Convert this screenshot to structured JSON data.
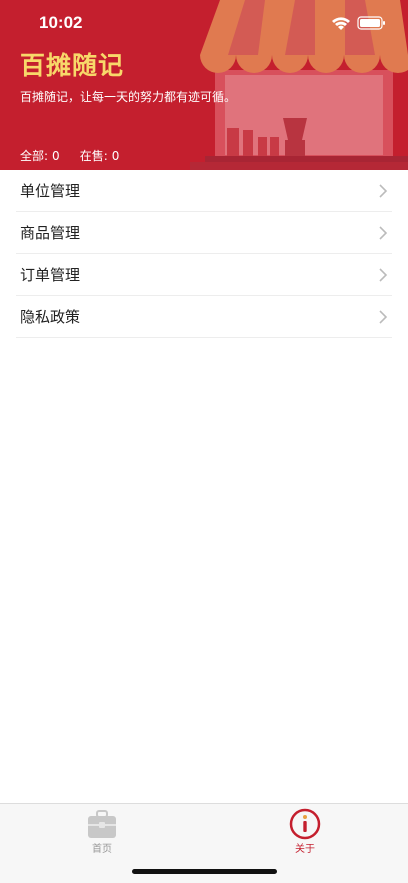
{
  "status_bar": {
    "time": "10:02"
  },
  "header": {
    "title": "百摊随记",
    "slogan": "百摊随记，让每一天的努力都有迹可循。",
    "stats": [
      {
        "label": "全部:",
        "value": "0"
      },
      {
        "label": "在售:",
        "value": "0"
      }
    ]
  },
  "menu": {
    "items": [
      {
        "label": "单位管理"
      },
      {
        "label": "商品管理"
      },
      {
        "label": "订单管理"
      },
      {
        "label": "隐私政策"
      }
    ]
  },
  "tabbar": {
    "tabs": [
      {
        "label": "首页",
        "icon": "briefcase-icon",
        "active": false
      },
      {
        "label": "关于",
        "icon": "info-icon",
        "active": true
      }
    ]
  },
  "colors": {
    "brand_red": "#C41F2E",
    "title_yellow": "#F8D86A",
    "awning_orange": "#E8824A"
  }
}
